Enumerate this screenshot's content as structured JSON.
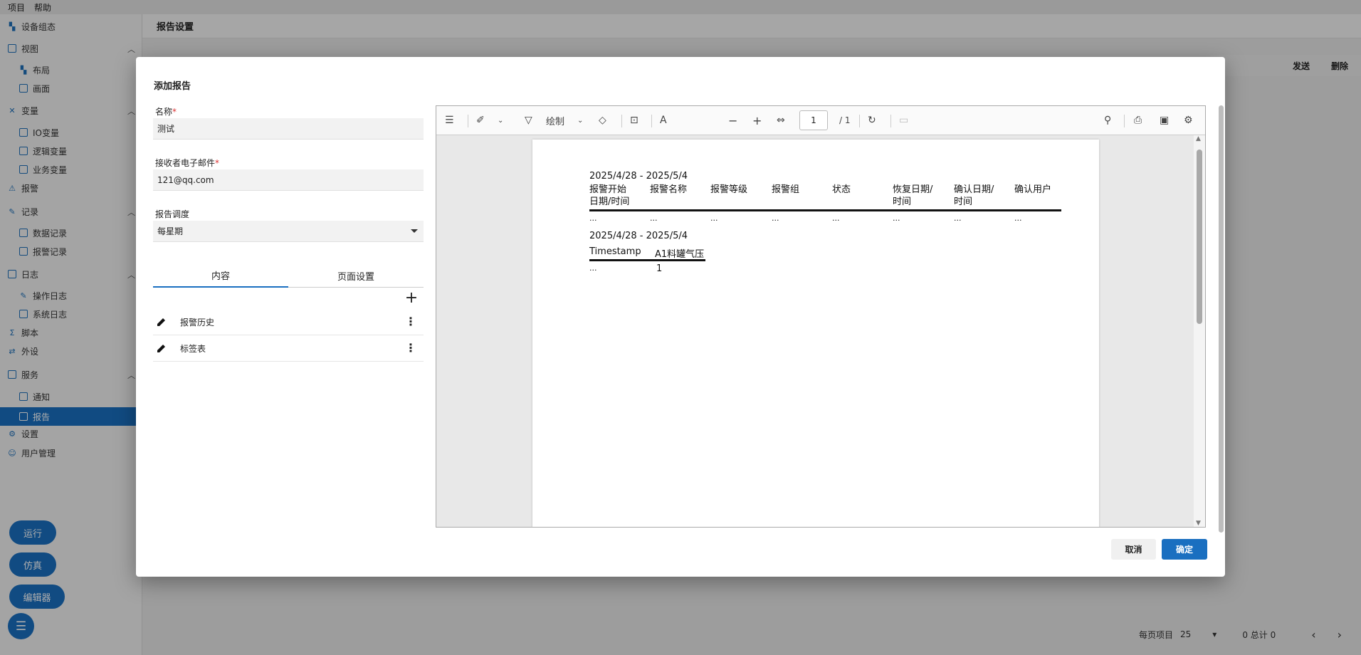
{
  "menubar": [
    "项目",
    "帮助"
  ],
  "sidebar": {
    "items": [
      {
        "label": "设备组态",
        "icon": "device-icon"
      },
      {
        "label": "视图",
        "icon": "view-icon"
      },
      {
        "label": "布局",
        "icon": "layout-icon"
      },
      {
        "label": "画面",
        "icon": "screen-icon"
      },
      {
        "label": "变量",
        "icon": "variable-icon"
      },
      {
        "label": "IO变量",
        "icon": "io-icon"
      },
      {
        "label": "逻辑变量",
        "icon": "logic-icon"
      },
      {
        "label": "业务变量",
        "icon": "business-icon"
      },
      {
        "label": "报警",
        "icon": "alarm-icon"
      },
      {
        "label": "记录",
        "icon": "record-icon"
      },
      {
        "label": "数据记录",
        "icon": "data-record-icon"
      },
      {
        "label": "报警记录",
        "icon": "alarm-record-icon"
      },
      {
        "label": "日志",
        "icon": "log-icon"
      },
      {
        "label": "操作日志",
        "icon": "op-log-icon"
      },
      {
        "label": "系统日志",
        "icon": "sys-log-icon"
      },
      {
        "label": "脚本",
        "icon": "script-icon"
      },
      {
        "label": "外设",
        "icon": "peripheral-icon"
      },
      {
        "label": "服务",
        "icon": "service-icon"
      },
      {
        "label": "通知",
        "icon": "notify-icon"
      },
      {
        "label": "报告",
        "icon": "report-icon"
      },
      {
        "label": "设置",
        "icon": "gear-icon"
      },
      {
        "label": "用户管理",
        "icon": "user-icon"
      }
    ],
    "buttons": {
      "run": "运行",
      "simulate": "仿真",
      "editor": "编辑器"
    }
  },
  "main": {
    "title": "报告设置",
    "send": "发送",
    "delete": "删除",
    "footer": {
      "per_page_label": "每页项目",
      "per_page_value": "25",
      "total": "0 总计 0"
    }
  },
  "dialog": {
    "title": "添加报告",
    "name_label": "名称",
    "name_value": "测试",
    "email_label": "接收者电子邮件",
    "email_value": "121@qq.com",
    "schedule_label": "报告调度",
    "schedule_value": "每星期",
    "required_mark": "*",
    "tabs": [
      "内容",
      "页面设置"
    ],
    "items": [
      "报警历史",
      "标签表"
    ],
    "cancel": "取消",
    "ok": "确定"
  },
  "viewer": {
    "draw_label": "绘制",
    "page_number": "1",
    "page_total": "/ 1"
  },
  "report": {
    "range1": "2025/4/28 - 2025/5/4",
    "alarm_columns": [
      [
        "报警开始",
        "日期/时间"
      ],
      [
        "报警名称",
        ""
      ],
      [
        "报警等级",
        ""
      ],
      [
        "报警组",
        ""
      ],
      [
        "状态",
        ""
      ],
      [
        "恢复日期/",
        "时间"
      ],
      [
        "确认日期/",
        "时间"
      ],
      [
        "确认用户",
        ""
      ]
    ],
    "ellipsis": "...",
    "range2": "2025/4/28 - 2025/5/4",
    "tag_columns": [
      "Timestamp",
      "A1料罐气压"
    ],
    "tag_row": [
      "...",
      "1"
    ]
  },
  "colors": {
    "accent": "#1a6fc0",
    "required": "#d33333"
  }
}
